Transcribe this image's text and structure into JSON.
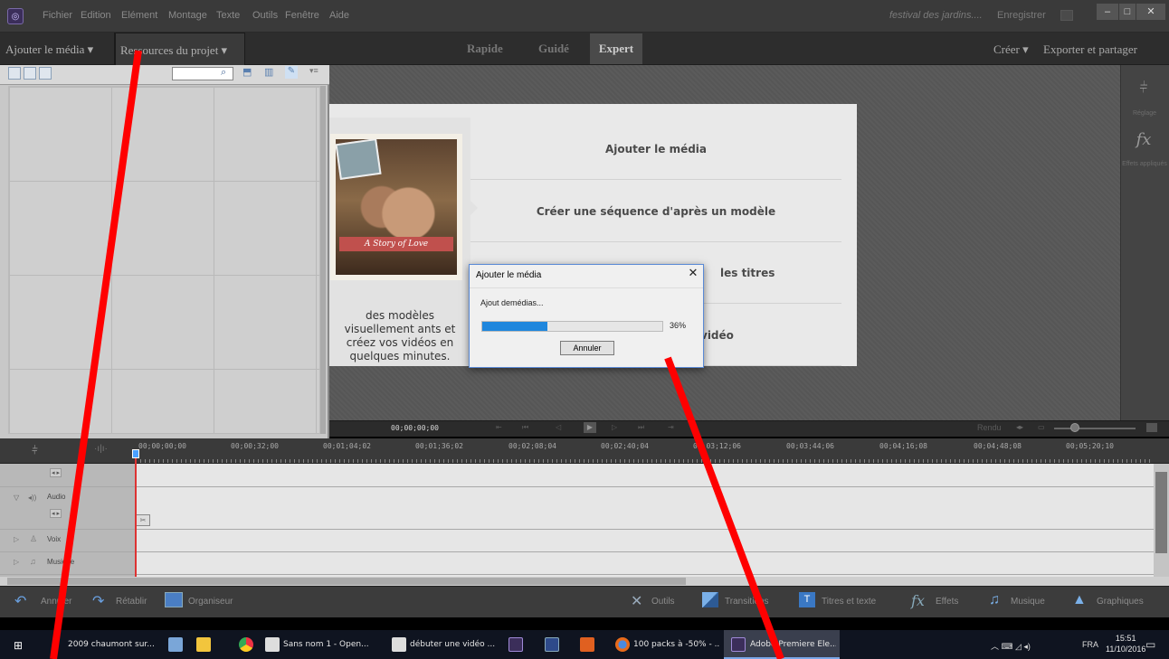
{
  "menubar": {
    "items": [
      "Fichier",
      "Edition",
      "Elément",
      "Montage",
      "Texte",
      "Outils",
      "Fenêtre",
      "Aide"
    ],
    "project_name": "festival des jardins....",
    "save_label": "Enregistrer",
    "window_controls": [
      "–",
      "□",
      "✕"
    ]
  },
  "modebar": {
    "add_media": "Ajouter le média ▾",
    "project_resources": "Ressources du projet ▾",
    "modes": [
      "Rapide",
      "Guidé",
      "Expert"
    ],
    "create": "Créer ▾",
    "export": "Exporter et partager"
  },
  "welcome": {
    "photo_caption": "A Story of Love",
    "description": "des modèles visuellement ants et créez vos vidéos en quelques minutes.",
    "options": [
      "Ajouter le média",
      "Créer une séquence d'après un modèle",
      "les titres",
      "vidéo"
    ]
  },
  "right_rail": {
    "adjust_label": "Réglage",
    "effects_label": "Effets appliqués"
  },
  "dialog": {
    "title": "Ajouter le média",
    "status": "Ajout demédias...",
    "progress_fraction": 0.36,
    "percent": "36%",
    "cancel": "Annuler"
  },
  "transport": {
    "timecode": "00;00;00;00",
    "render": "Rendu"
  },
  "timeline": {
    "ruler": [
      "00;00;00;00",
      "00;00;32;00",
      "00;01;04;02",
      "00;01;36;02",
      "00;02;08;04",
      "00;02;40;04",
      "00;03;12;06",
      "00;03;44;06",
      "00;04;16;08",
      "00;04;48;08",
      "00;05;20;10"
    ],
    "tracks": [
      "Audio",
      "Voix",
      "Musique"
    ]
  },
  "bottombar": {
    "undo": "Annuler",
    "redo": "Rétablir",
    "organizer": "Organiseur",
    "tools": "Outils",
    "transitions": "Transitions",
    "titles": "Titres et texte",
    "effects": "Effets",
    "music": "Musique",
    "graphics": "Graphiques"
  },
  "taskbar": {
    "items": [
      "2009 chaumont sur...",
      "Sans nom 1 - Open...",
      "débuter une vidéo ...",
      "100 packs à -50% - ...",
      "Adobe Premiere Ele..."
    ],
    "language": "FRA",
    "time": "15:51",
    "date": "11/10/2016"
  },
  "colors": {
    "accent": "#1e86dd",
    "annotation": "#ff0000",
    "playhead": "#dd3333"
  }
}
